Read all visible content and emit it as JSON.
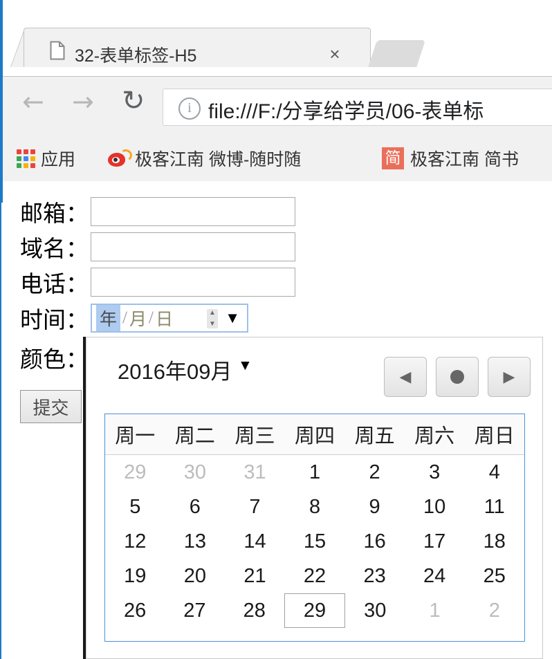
{
  "browser": {
    "tab": {
      "title": "32-表单标签-H5",
      "favicon": "page-icon",
      "close_label": "×"
    },
    "toolbar": {
      "back_icon": "←",
      "forward_icon": "→",
      "reload_icon": "↻",
      "info_icon": "i",
      "url": "file:///F:/分享给学员/06-表单标"
    },
    "bookmarks": [
      {
        "label": "应用",
        "icon": "apps-grid-icon"
      },
      {
        "label": "极客江南 微博-随时随",
        "icon": "weibo-icon"
      },
      {
        "label": "极客江南 简书",
        "icon": "jianshu-icon",
        "icon_text": "简"
      }
    ]
  },
  "form": {
    "rows": [
      {
        "label": "邮箱：",
        "type": "email",
        "value": "",
        "placeholder": ""
      },
      {
        "label": "域名：",
        "type": "url",
        "value": "",
        "placeholder": ""
      },
      {
        "label": "电话：",
        "type": "tel",
        "value": "",
        "placeholder": ""
      },
      {
        "label": "时间：",
        "type": "date"
      },
      {
        "label": "颜色：",
        "type": "color"
      }
    ],
    "date_input": {
      "year_placeholder": "年",
      "month_placeholder": "月",
      "day_placeholder": "日",
      "separator": "/",
      "spinner_up": "▲",
      "spinner_down": "▼",
      "dropdown_icon": "▼"
    },
    "submit_label": "提交"
  },
  "calendar": {
    "month_label": "2016年09月",
    "month_dropdown_icon": "▼",
    "nav": {
      "prev_icon": "◀",
      "today_icon": "●",
      "next_icon": "▶"
    },
    "weekdays": [
      "周一",
      "周二",
      "周三",
      "周四",
      "周五",
      "周六",
      "周日"
    ],
    "weeks": [
      [
        {
          "day": "29",
          "muted": true
        },
        {
          "day": "30",
          "muted": true
        },
        {
          "day": "31",
          "muted": true
        },
        {
          "day": "1"
        },
        {
          "day": "2"
        },
        {
          "day": "3"
        },
        {
          "day": "4"
        }
      ],
      [
        {
          "day": "5"
        },
        {
          "day": "6"
        },
        {
          "day": "7"
        },
        {
          "day": "8"
        },
        {
          "day": "9"
        },
        {
          "day": "10"
        },
        {
          "day": "11"
        }
      ],
      [
        {
          "day": "12"
        },
        {
          "day": "13"
        },
        {
          "day": "14"
        },
        {
          "day": "15"
        },
        {
          "day": "16"
        },
        {
          "day": "17"
        },
        {
          "day": "18"
        }
      ],
      [
        {
          "day": "19"
        },
        {
          "day": "20"
        },
        {
          "day": "21"
        },
        {
          "day": "22"
        },
        {
          "day": "23"
        },
        {
          "day": "24"
        },
        {
          "day": "25"
        }
      ],
      [
        {
          "day": "26"
        },
        {
          "day": "27"
        },
        {
          "day": "28"
        },
        {
          "day": "29",
          "today": true
        },
        {
          "day": "30"
        },
        {
          "day": "1",
          "muted": true
        },
        {
          "day": "2",
          "muted": true
        }
      ]
    ]
  },
  "colors": {
    "window_border": "#1d7ac8",
    "chrome_bg": "#f1f1f1",
    "date_focus_border": "#9dc0ea",
    "date_segment_highlight": "#aecbf0",
    "calendar_table_border": "#4a90d9",
    "jianshu_accent": "#ea6f5a",
    "weibo_red": "#e4322c"
  }
}
